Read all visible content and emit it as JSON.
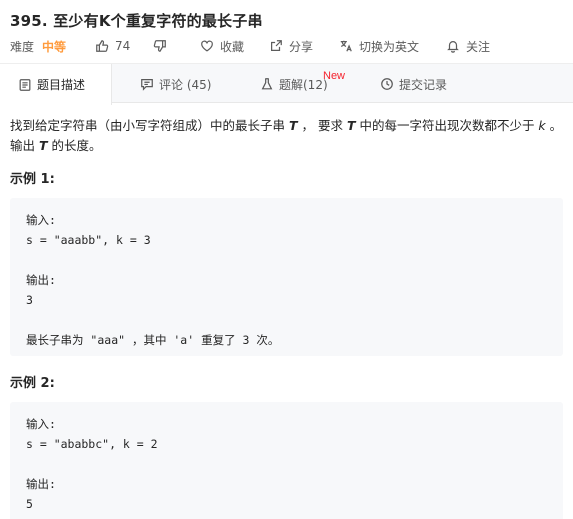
{
  "problem": {
    "title": "395. 至少有K个重复字符的最长子串"
  },
  "meta": {
    "difficulty_label": "难度",
    "difficulty_value": "中等",
    "like_count": "74",
    "favorite_label": "收藏",
    "share_label": "分享",
    "switch_lang_label": "切换为英文",
    "follow_label": "关注"
  },
  "tabs": [
    {
      "label": "题目描述"
    },
    {
      "label": "评论 (45)"
    },
    {
      "label": "题解(12)"
    },
    {
      "label": "提交记录"
    }
  ],
  "new_badge": "New",
  "description": {
    "p1": "找到给定字符串（由小写字符组成）中的最长子串 ",
    "T1": "T",
    "p2": " ， 要求 ",
    "T2": "T",
    "p3": " 中的每一字符出现次数都不少于 ",
    "k": "k",
    "p4": " 。输出 ",
    "T3": "T",
    "p5": " 的长度。"
  },
  "examples": [
    {
      "title": "示例 1:",
      "lines": [
        "输入:",
        "s = \"aaabb\", k = 3",
        "",
        "输出:",
        "3",
        "",
        "最长子串为 \"aaa\" ，其中 'a' 重复了 3 次。"
      ]
    },
    {
      "title": "示例 2:",
      "lines": [
        "输入:",
        "s = \"ababbc\", k = 2",
        "",
        "输出:",
        "5"
      ]
    }
  ],
  "colors": {
    "difficulty": "#ff9b3d",
    "new_badge": "#f5222d",
    "code_bg": "#f7f8fa"
  }
}
